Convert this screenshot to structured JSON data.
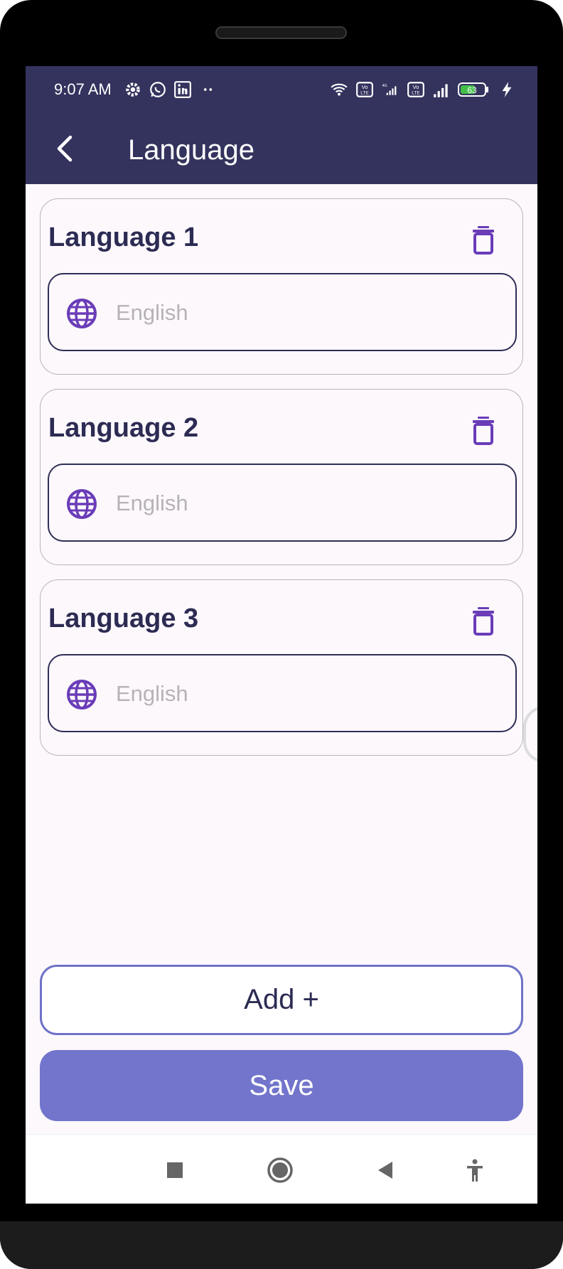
{
  "status_bar": {
    "time": "9:07 AM",
    "left_icons": [
      "gear-icon",
      "whatsapp-icon",
      "linkedin-icon",
      "more-dots-icon"
    ],
    "right_icons": [
      "wifi-icon",
      "volte-icon",
      "signal-4g-icon",
      "volte-icon",
      "signal-icon"
    ],
    "battery_level": "63"
  },
  "app_bar": {
    "title": "Language",
    "back_icon": "chevron-left-icon"
  },
  "languages": [
    {
      "label": "Language 1",
      "value": "English"
    },
    {
      "label": "Language 2",
      "value": "English"
    },
    {
      "label": "Language 3",
      "value": "English"
    }
  ],
  "actions": {
    "add_label": "Add +",
    "save_label": "Save"
  },
  "nav_bar": {
    "icons": [
      "recents-square-icon",
      "home-circle-icon",
      "back-triangle-icon",
      "accessibility-icon"
    ]
  },
  "colors": {
    "header": "#34335e",
    "accent": "#6a3cb8",
    "primary_button": "#7275cb",
    "outline_button": "#6f72c8",
    "background": "#fdf8fc"
  }
}
